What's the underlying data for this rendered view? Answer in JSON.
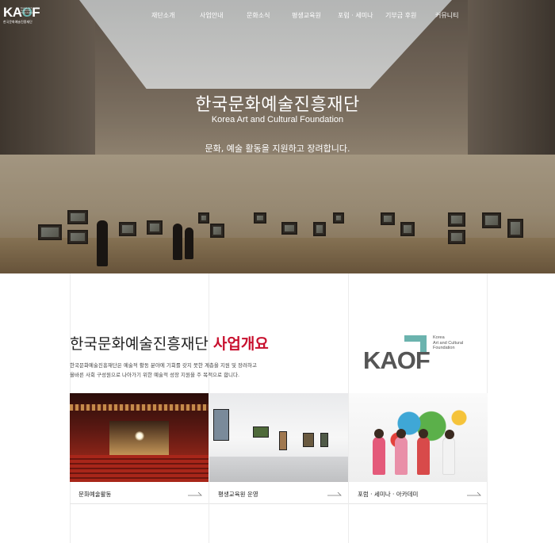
{
  "logo": {
    "mark_left": "KA",
    "mark_o": "O",
    "mark_right": "F",
    "tagline": "Korea Art and Cultural Foundation",
    "sub": "한국문화예술진흥재단"
  },
  "nav": {
    "items": [
      "재단소개",
      "사업안내",
      "문화소식",
      "평생교육원",
      "포럼 · 세미나",
      "기부금 후원",
      "커뮤니티"
    ]
  },
  "hero": {
    "title": "한국문화예술진흥재단",
    "subtitle_en": "Korea Art and Cultural Foundation",
    "slogan": "문화, 예술 활동을 지원하고 장려합니다."
  },
  "about": {
    "title_prefix": "한국문화예술진흥재단",
    "title_highlight": "사업개요",
    "desc_line1": "한국문화예술진흥재단은 예술적 활동 분야에 기회를 갖지 못한 계층을 지원 및 장려하고",
    "desc_line2": "올바른 사회 구성원으로 나아가기 위한 예술적 성장 지원을 주 목적으로 합니다."
  },
  "brand_logo": {
    "mark": "KAOF",
    "text_line1": "Korea",
    "text_line2": "Art and Cultural",
    "text_line3": "Foundation"
  },
  "cards": [
    {
      "label": "문화예술활동"
    },
    {
      "label": "평생교육원 운영"
    },
    {
      "label": "포럼 · 세미나 · 아카데미"
    }
  ],
  "colors": {
    "accent": "#c8102e",
    "brand_teal": "#6bb3ae"
  }
}
